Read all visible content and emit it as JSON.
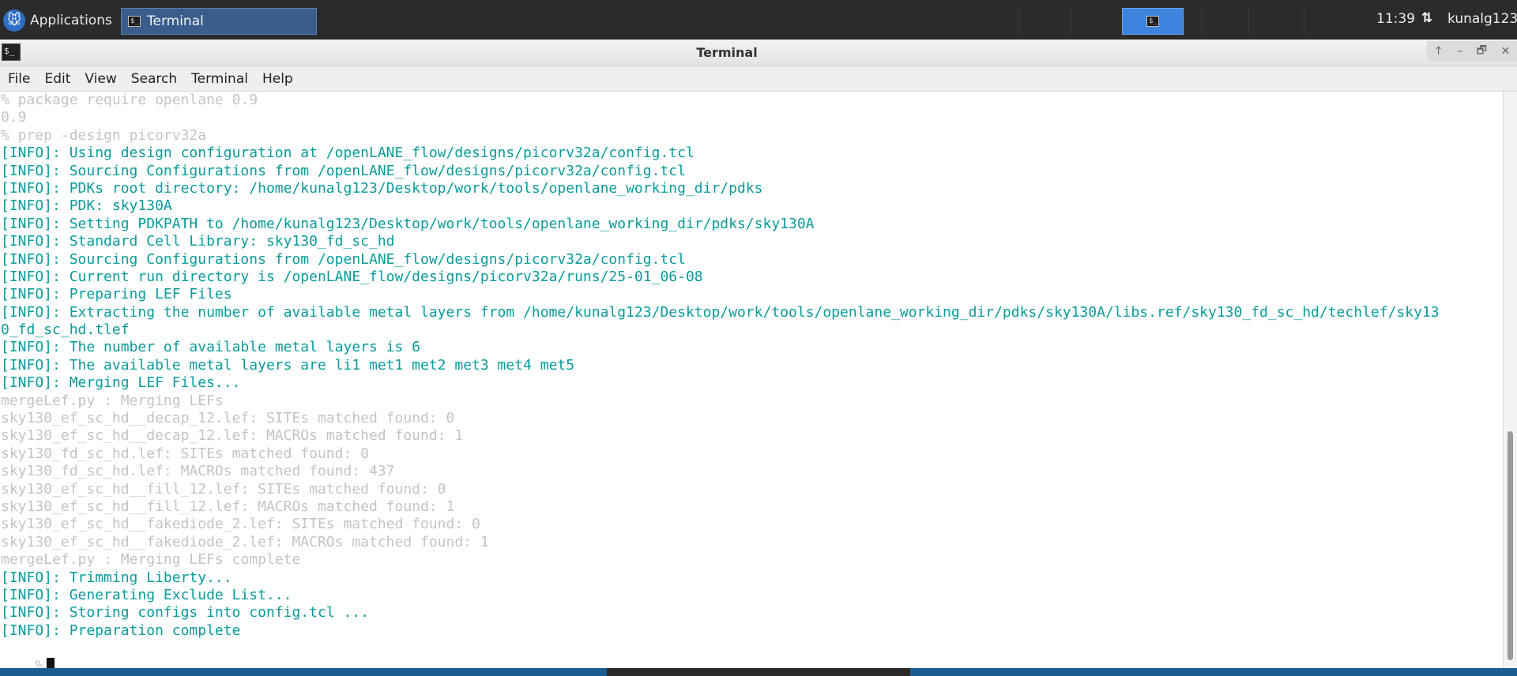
{
  "panel": {
    "applications_label": "Applications",
    "task_label": "Terminal",
    "clock": "11:39",
    "user": "kunalg123"
  },
  "window": {
    "title": "Terminal",
    "controls": [
      "↑",
      "–",
      "🗗",
      "✕"
    ]
  },
  "menu": [
    "File",
    "Edit",
    "View",
    "Search",
    "Terminal",
    "Help"
  ],
  "terminal": {
    "prompt": "%",
    "lines": [
      {
        "style": "dim",
        "text": "% package require openlane 0.9"
      },
      {
        "style": "dim",
        "text": "0.9"
      },
      {
        "style": "dim",
        "text": "% prep -design picorv32a"
      },
      {
        "style": "info",
        "text": "[INFO]: Using design configuration at /openLANE_flow/designs/picorv32a/config.tcl"
      },
      {
        "style": "info",
        "text": "[INFO]: Sourcing Configurations from /openLANE_flow/designs/picorv32a/config.tcl"
      },
      {
        "style": "info",
        "text": "[INFO]: PDKs root directory: /home/kunalg123/Desktop/work/tools/openlane_working_dir/pdks"
      },
      {
        "style": "info",
        "text": "[INFO]: PDK: sky130A"
      },
      {
        "style": "info",
        "text": "[INFO]: Setting PDKPATH to /home/kunalg123/Desktop/work/tools/openlane_working_dir/pdks/sky130A"
      },
      {
        "style": "info",
        "text": "[INFO]: Standard Cell Library: sky130_fd_sc_hd"
      },
      {
        "style": "info",
        "text": "[INFO]: Sourcing Configurations from /openLANE_flow/designs/picorv32a/config.tcl"
      },
      {
        "style": "info",
        "text": "[INFO]: Current run directory is /openLANE_flow/designs/picorv32a/runs/25-01_06-08"
      },
      {
        "style": "info",
        "text": "[INFO]: Preparing LEF Files"
      },
      {
        "style": "info",
        "text": "[INFO]: Extracting the number of available metal layers from /home/kunalg123/Desktop/work/tools/openlane_working_dir/pdks/sky130A/libs.ref/sky130_fd_sc_hd/techlef/sky13"
      },
      {
        "style": "info",
        "text": "0_fd_sc_hd.tlef"
      },
      {
        "style": "info",
        "text": "[INFO]: The number of available metal layers is 6"
      },
      {
        "style": "info",
        "text": "[INFO]: The available metal layers are li1 met1 met2 met3 met4 met5"
      },
      {
        "style": "info",
        "text": "[INFO]: Merging LEF Files..."
      },
      {
        "style": "dim",
        "text": "mergeLef.py : Merging LEFs"
      },
      {
        "style": "dim",
        "text": "sky130_ef_sc_hd__decap_12.lef: SITEs matched found: 0"
      },
      {
        "style": "dim",
        "text": "sky130_ef_sc_hd__decap_12.lef: MACROs matched found: 1"
      },
      {
        "style": "dim",
        "text": "sky130_fd_sc_hd.lef: SITEs matched found: 0"
      },
      {
        "style": "dim",
        "text": "sky130_fd_sc_hd.lef: MACROs matched found: 437"
      },
      {
        "style": "dim",
        "text": "sky130_ef_sc_hd__fill_12.lef: SITEs matched found: 0"
      },
      {
        "style": "dim",
        "text": "sky130_ef_sc_hd__fill_12.lef: MACROs matched found: 1"
      },
      {
        "style": "dim",
        "text": "sky130_ef_sc_hd__fakediode_2.lef: SITEs matched found: 0"
      },
      {
        "style": "dim",
        "text": "sky130_ef_sc_hd__fakediode_2.lef: MACROs matched found: 1"
      },
      {
        "style": "dim",
        "text": "mergeLef.py : Merging LEFs complete"
      },
      {
        "style": "info",
        "text": "[INFO]: Trimming Liberty..."
      },
      {
        "style": "info",
        "text": "[INFO]: Generating Exclude List..."
      },
      {
        "style": "info",
        "text": "[INFO]: Storing configs into config.tcl ..."
      },
      {
        "style": "info",
        "text": "[INFO]: Preparation complete"
      }
    ]
  },
  "colors": {
    "info": "#0a9b9b",
    "dim": "#c4c4c4",
    "workspace": "#3e84de"
  }
}
